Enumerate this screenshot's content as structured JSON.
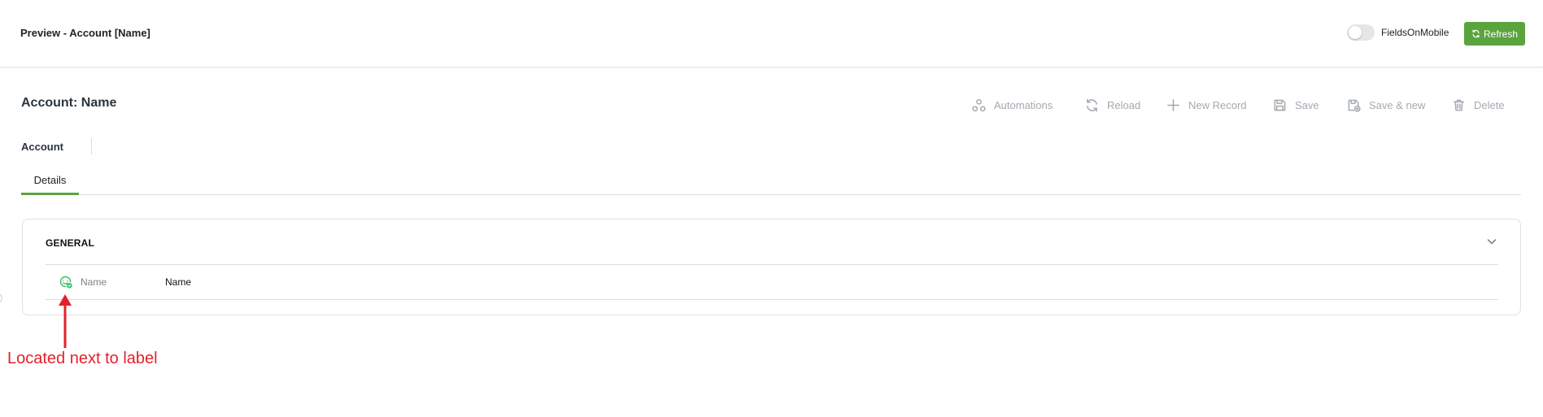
{
  "topbar": {
    "title": "Preview - Account [Name]",
    "toggle_label": "FieldsOnMobile",
    "toggle_on": false,
    "refresh_label": "Refresh",
    "refresh_color": "#5aa43d"
  },
  "record": {
    "title": "Account: Name",
    "entity_label": "Account"
  },
  "actions": {
    "automations": "Automations",
    "reload": "Reload",
    "new_record": "New Record",
    "save": "Save",
    "save_new": "Save & new",
    "delete": "Delete"
  },
  "tabs": [
    {
      "label": "Details",
      "active": true
    }
  ],
  "section": {
    "header": "GENERAL",
    "fields": [
      {
        "label": "Name",
        "value": "Name",
        "icon": "field-status-icon",
        "icon_color": "#3cc36b"
      }
    ]
  },
  "annotation": {
    "text": "Located next to label",
    "color": "#e4212b"
  }
}
